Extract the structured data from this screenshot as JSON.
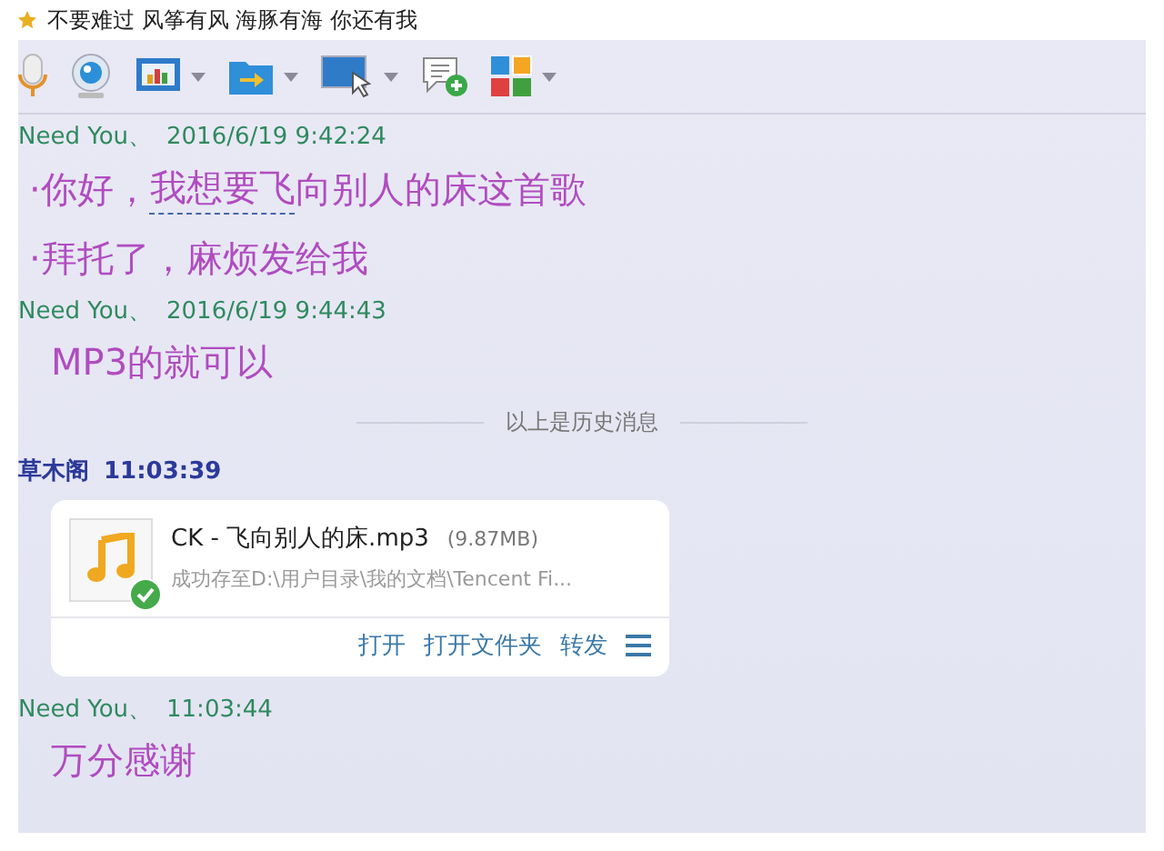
{
  "signature": {
    "text": "不要难过 风筝有风 海豚有海 你还有我"
  },
  "toolbar": [
    {
      "kind": "microphone",
      "dropdown": false
    },
    {
      "kind": "webcam",
      "dropdown": false
    },
    {
      "kind": "screen-chart",
      "dropdown": true
    },
    {
      "kind": "folder-send",
      "dropdown": true
    },
    {
      "kind": "screen-cursor",
      "dropdown": true
    },
    {
      "kind": "chat-add",
      "dropdown": false
    },
    {
      "kind": "apps",
      "dropdown": true
    }
  ],
  "messages": [
    {
      "kind": "text",
      "sender": "Need You、",
      "time": "2016/6/19 9:42:24",
      "self": false,
      "lines": [
        {
          "kind": "link",
          "bullet": "·",
          "before": "你好，",
          "link": "我想要飞",
          "after": "向别人的床这首歌"
        },
        {
          "kind": "plain",
          "bullet": "·",
          "text": "拜托了，麻烦发给我"
        }
      ]
    },
    {
      "kind": "text",
      "sender": "Need You、",
      "time": "2016/6/19 9:44:43",
      "self": false,
      "lines": [
        {
          "kind": "plain",
          "text": "MP3的就可以"
        }
      ]
    },
    {
      "kind": "divider",
      "text": "以上是历史消息"
    },
    {
      "kind": "file",
      "sender": "草木阁",
      "time": "11:03:39",
      "self": true,
      "file": {
        "name": "CK - 飞向别人的床.mp3",
        "size": "(9.87MB)",
        "status": "成功存至D:\\用户目录\\我的文档\\Tencent Fi...",
        "done": true,
        "actions": [
          "打开",
          "打开文件夹",
          "转发"
        ]
      }
    },
    {
      "kind": "text",
      "sender": "Need You、",
      "time": "11:03:44",
      "self": false,
      "lines": [
        {
          "kind": "plain",
          "text": "万分感谢"
        }
      ]
    }
  ]
}
